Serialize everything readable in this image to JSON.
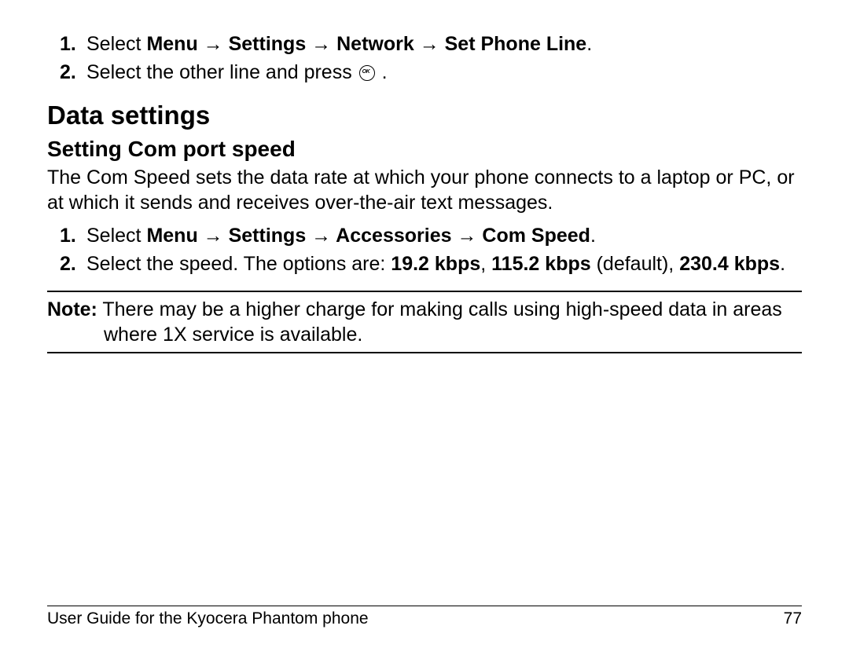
{
  "steps_top": {
    "s1_prefix": "Select ",
    "s1_path": "Menu → Settings → Network → Set Phone Line",
    "s1_suffix": ".",
    "s2_before": "Select the other line and press ",
    "s2_after": " ."
  },
  "section_title": "Data settings",
  "subsection_title": "Setting Com port speed",
  "com_intro": "The Com Speed sets the data rate at which your phone connects to a laptop or PC, or at which it sends and receives over-the-air text messages.",
  "steps_com": {
    "s1_prefix": "Select ",
    "s1_path": "Menu → Settings → Accessories → Com Speed",
    "s1_suffix": ".",
    "s2_before": "Select the speed. The options are: ",
    "s2_opt1": "19.2 kbps",
    "s2_sep1": ", ",
    "s2_opt2": "115.2 kbps",
    "s2_default": " (default), ",
    "s2_opt3": "230.4 kbps",
    "s2_suffix": "."
  },
  "note": {
    "label": "Note:",
    "text_a": " There may be a higher charge for making calls using high-speed data",
    "text_b": "in areas where 1X service is available."
  },
  "footer": {
    "left": "User Guide for the Kyocera Phantom phone",
    "right": "77"
  }
}
